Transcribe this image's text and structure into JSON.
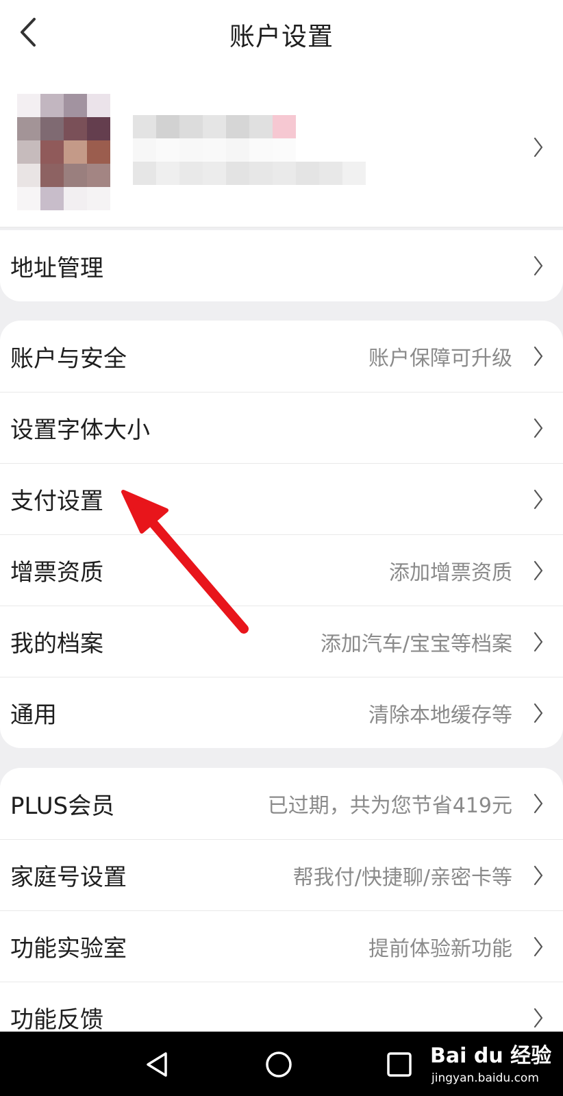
{
  "header": {
    "title": "账户设置",
    "back_icon": "chevron-left-icon"
  },
  "profile": {
    "chevron_icon": "chevron-right-icon"
  },
  "section1": [
    {
      "label": "地址管理",
      "value": ""
    }
  ],
  "section2": [
    {
      "label": "账户与安全",
      "value": "账户保障可升级"
    },
    {
      "label": "设置字体大小",
      "value": ""
    },
    {
      "label": "支付设置",
      "value": ""
    },
    {
      "label": "增票资质",
      "value": "添加增票资质"
    },
    {
      "label": "我的档案",
      "value": "添加汽车/宝宝等档案"
    },
    {
      "label": "通用",
      "value": "清除本地缓存等"
    }
  ],
  "section3": [
    {
      "label": "PLUS会员",
      "value": "已过期，共为您节省419元"
    },
    {
      "label": "家庭号设置",
      "value": "帮我付/快捷聊/亲密卡等"
    },
    {
      "label": "功能实验室",
      "value": "提前体验新功能"
    },
    {
      "label": "功能反馈",
      "value": ""
    }
  ],
  "annotation": {
    "color": "#e8151b",
    "icon": "red-arrow-icon"
  },
  "navbar": {
    "back_icon": "triangle-back-icon",
    "home_icon": "circle-home-icon",
    "recent_icon": "square-recent-icon"
  },
  "watermark": {
    "brand": "Bai du 经验",
    "site": "jingyan.baidu.com"
  },
  "colors": {
    "background": "#efeff1",
    "card": "#ffffff",
    "text": "#1e1e1e",
    "secondary": "#8a8a8a"
  }
}
